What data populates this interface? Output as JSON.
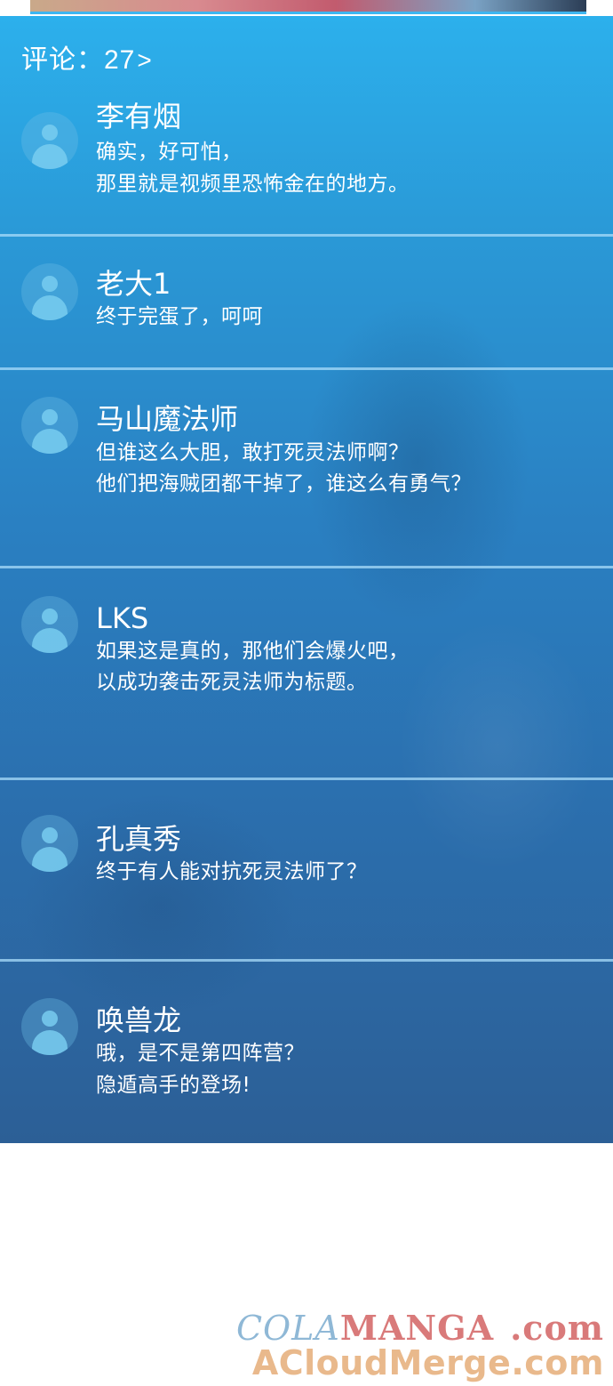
{
  "header": {
    "label": "评论：",
    "count": "27",
    "chevron": ">"
  },
  "comments": [
    {
      "username": "李有烟",
      "lines": [
        "确实，好可怕，",
        "那里就是视频里恐怖金在的地方。"
      ]
    },
    {
      "username": "老大1",
      "lines": [
        "终于完蛋了，呵呵"
      ]
    },
    {
      "username": "马山魔法师",
      "lines": [
        "但谁这么大胆，敢打死灵法师啊？",
        "他们把海贼团都干掉了，谁这么有勇气？"
      ]
    },
    {
      "username": "LKS",
      "lines": [
        "如果这是真的，那他们会爆火吧，",
        "以成功袭击死灵法师为标题。"
      ]
    },
    {
      "username": "孔真秀",
      "lines": [
        "终于有人能对抗死灵法师了？"
      ]
    },
    {
      "username": "唤兽龙",
      "lines": [
        "哦，是不是第四阵营？",
        "隐遁高手的登场!"
      ]
    }
  ],
  "watermark": {
    "line1_part1": "COLA",
    "line1_part2": "MANGA",
    "line1_part3": ".com",
    "line2": "ACloudMerge.com"
  },
  "colors": {
    "panel_top": "#2cb0ec",
    "panel_bottom": "#2c5f96",
    "divider": "#aadcfa",
    "text": "#ffffff"
  }
}
